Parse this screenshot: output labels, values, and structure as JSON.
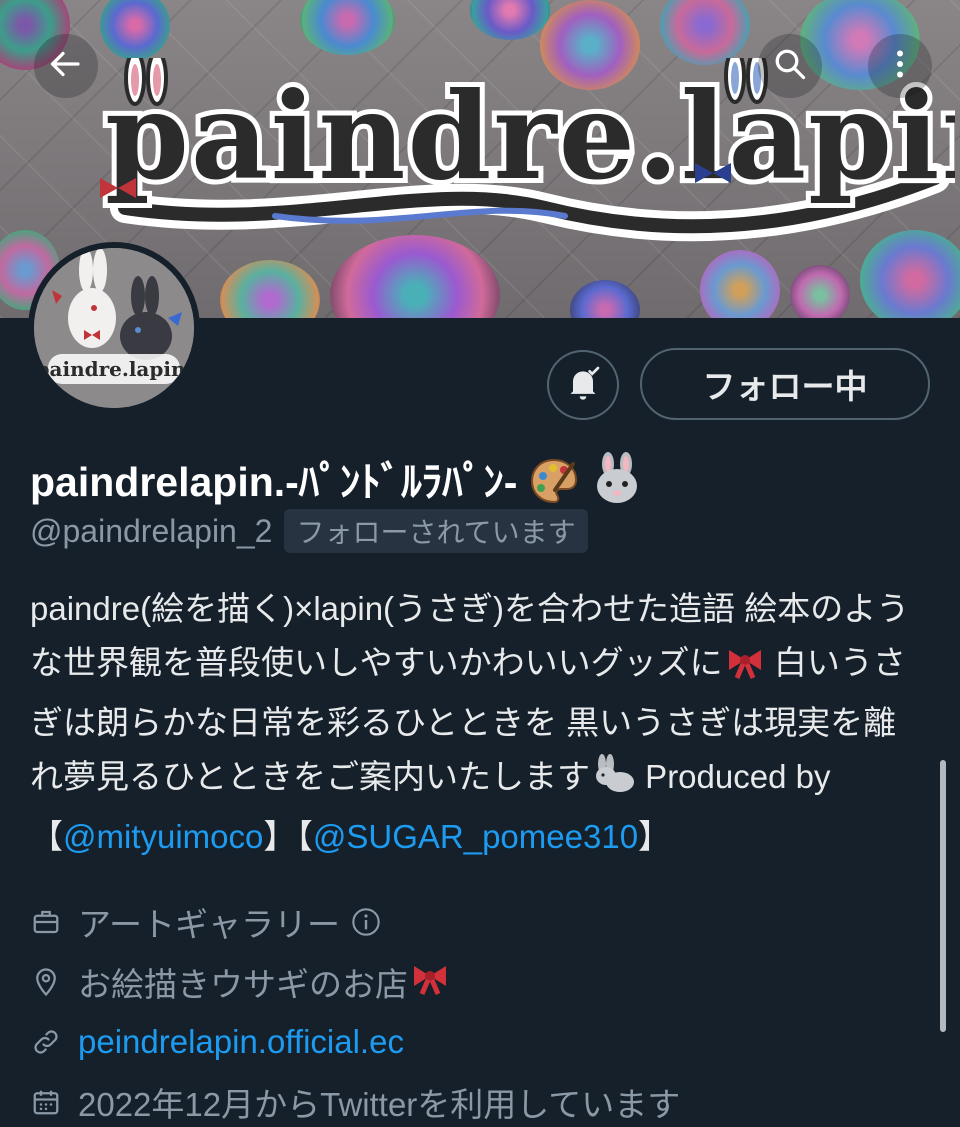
{
  "header": {
    "back_icon": "arrow-left-icon",
    "search_icon": "search-icon",
    "more_icon": "more-vertical-icon",
    "banner_logo_text": "paindre.lapin."
  },
  "avatar": {
    "logo_text": "paindre.lapin."
  },
  "actions": {
    "notify_icon": "bell-check-icon",
    "follow_label": "フォロー中"
  },
  "profile": {
    "display_name": "paindrelapin.-ﾊﾟﾝﾄﾞﾙﾗﾊﾟﾝ-",
    "name_emojis": [
      "artist-palette-emoji",
      "rabbit-face-emoji"
    ],
    "handle": "@paindrelapin_2",
    "follows_you": "フォローされています"
  },
  "bio": {
    "text1": "paindre(絵を描く)×lapin(うさぎ)を合わせた造語 絵本のような世界観を普段使いしやすいかわいいグッズに",
    "text2": " 白いうさぎは朗らかな日常を彩るひとときを 黒いうさぎは現実を離れ夢見るひとときをご案内いたします",
    "text3": " Produced by【",
    "mention1": "@mityuimoco",
    "text4": "】【",
    "mention2": "@SUGAR_pomee310",
    "text5": "】"
  },
  "meta": {
    "category": "アートギャラリー",
    "category_icon": "briefcase-icon",
    "info_icon": "info-circle-icon",
    "location": "お絵描きウサギのお店",
    "location_icon": "location-pin-icon",
    "website": "peindrelapin.official.ec",
    "website_icon": "link-icon",
    "joined": "2022年12月からTwitterを利用しています",
    "joined_icon": "calendar-icon"
  },
  "colors": {
    "background": "#15202b",
    "link": "#1d9bf0",
    "muted": "#8b98a5",
    "text": "#e7e9ea"
  }
}
